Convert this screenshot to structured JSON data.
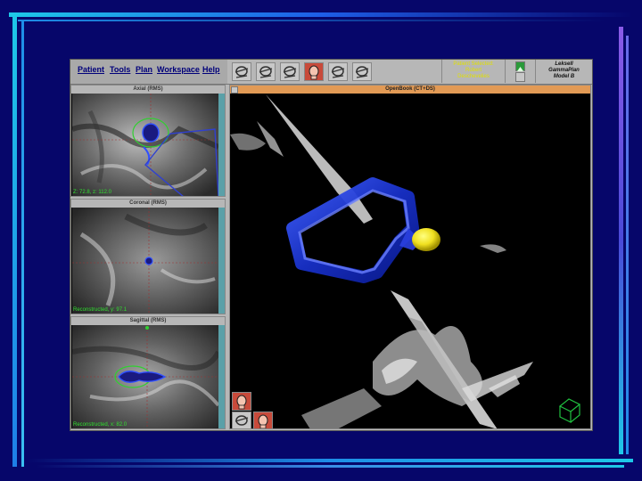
{
  "menu": {
    "items": [
      {
        "label": "Patient"
      },
      {
        "label": "Tools"
      },
      {
        "label": "Plan"
      },
      {
        "label": "Workspace"
      },
      {
        "label": "Help"
      }
    ]
  },
  "patient": {
    "line1": "Patient Selected:",
    "line2": "Robert",
    "line3": "Deschevelies"
  },
  "product": {
    "line1": "Leksell",
    "line2": "GammaPlan",
    "line3": "Model B"
  },
  "panels": {
    "axial": {
      "title": "Axial (RMS)",
      "status": "Z: 72.8, z: 112.0"
    },
    "coronal": {
      "title": "Coronal (RMS)",
      "status": "Reconstructed, y: 97.1"
    },
    "sagittal": {
      "title": "Sagittal (RMS)",
      "status": "Reconstructed, x: 82.0"
    }
  },
  "view3d": {
    "title": "OpenBook (CT+DS)"
  },
  "colors": {
    "background": "#06066a",
    "accent_bar": "#1ec8e8",
    "structure": "#2840e8",
    "target": "#f0f020",
    "active_tool": "#c84a3a",
    "status_text": "#30e030"
  },
  "icons": {
    "toolbar": [
      "head-tool-icon",
      "head-tool-icon",
      "head-tool-icon",
      "head-active-icon",
      "head-tool-icon",
      "head-tool-icon"
    ]
  }
}
